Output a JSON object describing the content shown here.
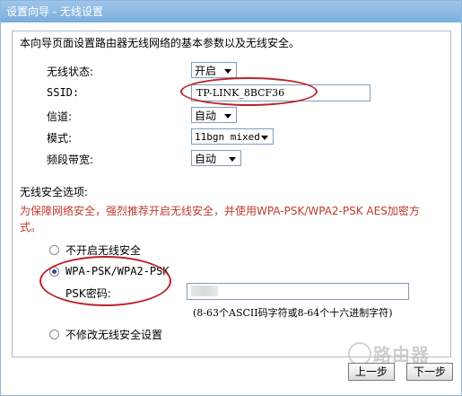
{
  "window": {
    "title": "设置向导 - 无线设置"
  },
  "description": "本向导页面设置路由器无线网络的基本参数以及无线安全。",
  "fields": {
    "wireless_status": {
      "label": "无线状态:",
      "value": "开启"
    },
    "ssid": {
      "label": "SSID:",
      "value": "TP-LINK_8BCF36"
    },
    "channel": {
      "label": "信道:",
      "value": "自动"
    },
    "mode": {
      "label": "模式:",
      "value": "11bgn mixed"
    },
    "bandwidth": {
      "label": "频段带宽:",
      "value": "自动"
    }
  },
  "security": {
    "heading": "无线安全选项:",
    "warning_line1": "为保障网络安全，强烈推荐开启无线安全，并使用WPA-PSK/WPA2-PSK AES加密方",
    "warning_line2": "式。",
    "option_off": "不开启无线安全",
    "option_wpa": "WPA-PSK/WPA2-PSK",
    "psk_label": "PSK密码:",
    "psk_value": "",
    "psk_hint": "(8-63个ASCII码字符或8-64个十六进制字符)",
    "option_keep": "不修改无线安全设置"
  },
  "buttons": {
    "prev": "上一步",
    "next": "下一步"
  },
  "watermark": {
    "text": "路由器"
  },
  "colors": {
    "titlebar": "#8dbbe6",
    "warning_text": "#c0392b",
    "annotation_ellipse": "#b8242d"
  }
}
